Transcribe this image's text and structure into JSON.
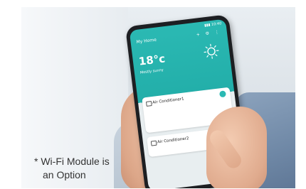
{
  "photo": {
    "description_colors": {
      "accent": "#2bb9b3",
      "text": "#333333"
    }
  },
  "phone": {
    "status": "▮▮▮ 10:40",
    "home_label": "My Home",
    "weather": {
      "temperature": "18°c",
      "condition": "Mostly sunny"
    },
    "devices": [
      {
        "name": "Air Conditioner1"
      },
      {
        "name": "Air Conditioner2"
      }
    ]
  },
  "note": {
    "line1": "* Wi-Fi Module is",
    "line2": "an Option"
  }
}
